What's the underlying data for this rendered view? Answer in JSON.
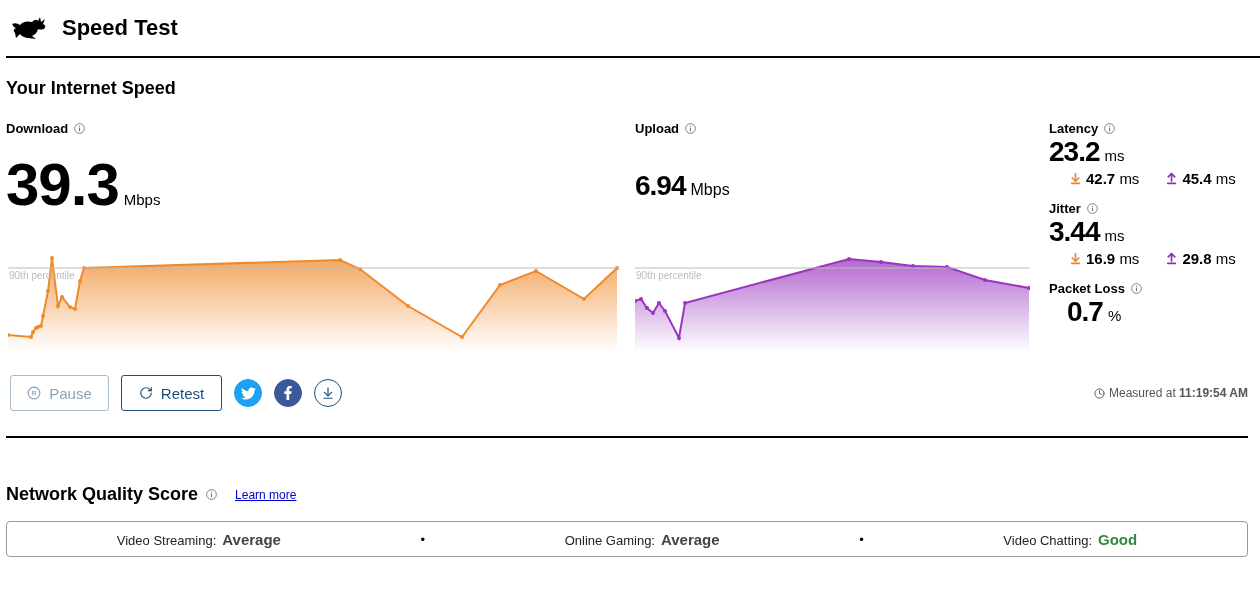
{
  "header": {
    "title": "Speed Test"
  },
  "section_title": "Your Internet Speed",
  "download": {
    "label": "Download",
    "value": "39.3",
    "unit": "Mbps",
    "percentile_label": "90th percentile"
  },
  "upload": {
    "label": "Upload",
    "value": "6.94",
    "unit": "Mbps",
    "percentile_label": "90th percentile"
  },
  "metrics": [
    {
      "label": "Latency",
      "value": "23.2",
      "unit": "ms",
      "down": {
        "value": "42.7",
        "unit": "ms"
      },
      "up": {
        "value": "45.4",
        "unit": "ms"
      }
    },
    {
      "label": "Jitter",
      "value": "3.44",
      "unit": "ms",
      "down": {
        "value": "16.9",
        "unit": "ms"
      },
      "up": {
        "value": "29.8",
        "unit": "ms"
      }
    },
    {
      "label": "Packet Loss",
      "value": "0.7",
      "unit": "%"
    }
  ],
  "buttons": [
    {
      "kind": "pause",
      "label": "Pause",
      "disabled": true
    },
    {
      "kind": "retest",
      "label": "Retest",
      "disabled": false
    }
  ],
  "measured": "Measured at **11:19:54 AM**",
  "quality": {
    "title": "Network Quality Score",
    "link": "Learn more",
    "separators": [
      "•",
      "•"
    ],
    "items": [
      {
        "label": "Video Streaming:",
        "rating": "Average",
        "color": "#444444"
      },
      {
        "label": "Online Gaming:",
        "rating": "Average",
        "color": "#444444"
      },
      {
        "label": "Video Chatting:",
        "rating": "Good",
        "color": "#2e8b3e"
      }
    ]
  }
}
